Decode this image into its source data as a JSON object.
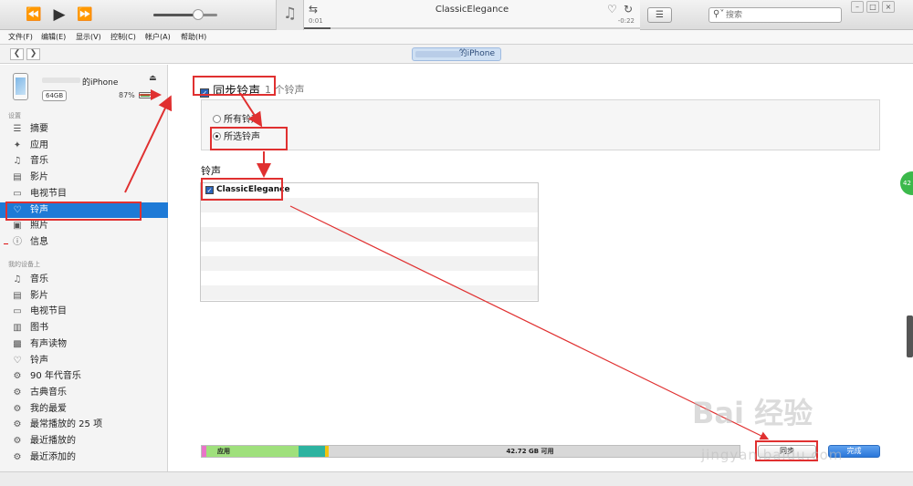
{
  "player": {
    "track_title": "ClassicElegance",
    "elapsed": "0:01",
    "remaining": "-0:22",
    "volume_percent": 70,
    "progress_percent": 8
  },
  "search": {
    "placeholder": "搜索"
  },
  "menu": [
    "文件(F)",
    "编辑(E)",
    "显示(V)",
    "控制(C)",
    "帐户(A)",
    "帮助(H)"
  ],
  "nav": {
    "device_pill": "的iPhone"
  },
  "device": {
    "name": "的iPhone",
    "capacity": "64GB",
    "battery": "87%",
    "battery_percent": 87
  },
  "sidebar": {
    "settings_header": "设置",
    "settings_items": [
      {
        "label": "摘要",
        "icon": "summary-icon"
      },
      {
        "label": "应用",
        "icon": "apps-icon"
      },
      {
        "label": "音乐",
        "icon": "music-icon"
      },
      {
        "label": "影片",
        "icon": "film-icon"
      },
      {
        "label": "电视节目",
        "icon": "tv-icon"
      },
      {
        "label": "铃声",
        "icon": "bell-icon",
        "active": true
      },
      {
        "label": "照片",
        "icon": "camera-icon"
      },
      {
        "label": "信息",
        "icon": "info-icon"
      }
    ],
    "device_header": "我的设备上",
    "device_items": [
      {
        "label": "音乐",
        "icon": "music-icon"
      },
      {
        "label": "影片",
        "icon": "film-icon"
      },
      {
        "label": "电视节目",
        "icon": "tv-icon"
      },
      {
        "label": "图书",
        "icon": "book-icon"
      },
      {
        "label": "有声读物",
        "icon": "audiobook-icon"
      },
      {
        "label": "铃声",
        "icon": "bell-icon"
      },
      {
        "label": "90 年代音乐",
        "icon": "gear-icon"
      },
      {
        "label": "古典音乐",
        "icon": "gear-icon"
      },
      {
        "label": "我的最爱",
        "icon": "gear-icon"
      },
      {
        "label": "最常播放的 25 项",
        "icon": "gear-icon"
      },
      {
        "label": "最近播放的",
        "icon": "gear-icon"
      },
      {
        "label": "最近添加的",
        "icon": "gear-icon"
      }
    ]
  },
  "main": {
    "sync_label": "同步铃声",
    "sync_count": "1 个铃声",
    "option_all": "所有铃声",
    "option_selected": "所选铃声",
    "section_title": "铃声",
    "ringtones": [
      "ClassicElegance"
    ],
    "storage_app_label": "应用",
    "storage_free_label": "42.72 GB 可用",
    "sync_button": "同步",
    "done_button": "完成"
  },
  "colors": {
    "accent": "#1e7ad6",
    "annotation_red": "#e03030",
    "storage_pink": "#e873c8",
    "storage_green": "#9fe07c",
    "storage_teal": "#2db3a0",
    "storage_yellow": "#f2c40f"
  },
  "badge": {
    "text": "42"
  },
  "watermark": {
    "main": "Bai 经验",
    "sub": "jingyan.baidu.com"
  }
}
